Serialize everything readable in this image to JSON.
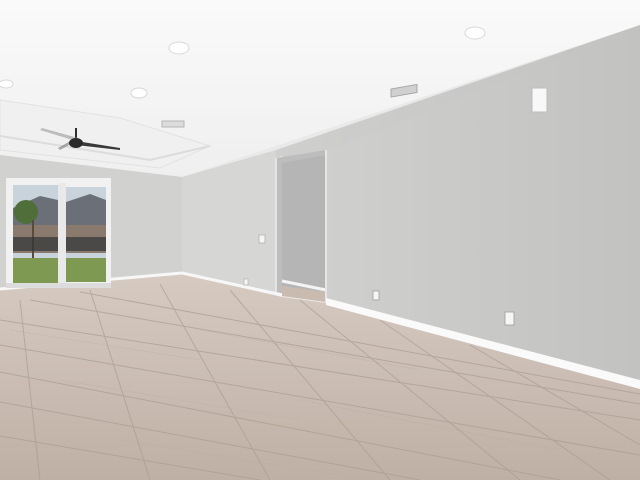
{
  "scene": {
    "kind": "empty-room-interior",
    "colors": {
      "ceiling": "#f6f6f6",
      "tray_ceiling": "#f2f2f2",
      "wall_right": "#c9c9c8",
      "wall_back": "#d3d3d2",
      "wall_left": "#cfcfcf",
      "hallway": "#bfbfbf",
      "baseboard": "#ffffff",
      "floor_light": "#cdbfb5",
      "floor_dark": "#b3a59b",
      "grout": "#a89a90",
      "sky": "#c9d4dc",
      "lawn": "#7e9a52",
      "window_frame": "#f3f3f3"
    },
    "fixtures": [
      {
        "kind": "recessed-light",
        "count": 4
      },
      {
        "kind": "ceiling-fan",
        "count": 1
      },
      {
        "kind": "hvac-vent",
        "count": 2
      },
      {
        "kind": "thermostat",
        "count": 1
      },
      {
        "kind": "outlet",
        "count": 3
      },
      {
        "kind": "light-switch",
        "count": 1
      }
    ],
    "elements": [
      "sliding-glass-door",
      "hallway-opening",
      "tile-floor",
      "tray-ceiling"
    ]
  }
}
